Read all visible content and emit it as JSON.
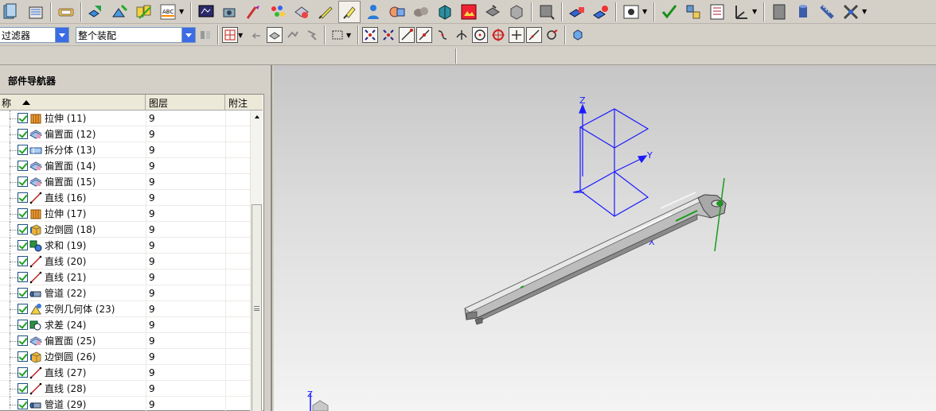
{
  "filter_bar": {
    "filter_combo": "过滤器",
    "scope_combo": "整个装配"
  },
  "navigator": {
    "title": "部件导航器",
    "columns": {
      "name": "称",
      "layer": "图层",
      "note": "附注"
    },
    "rows": [
      {
        "name": "拉伸 (11)",
        "layer": "9",
        "icon": "extrude-icon"
      },
      {
        "name": "偏置面 (12)",
        "layer": "9",
        "icon": "offset-face-icon"
      },
      {
        "name": "拆分体 (13)",
        "layer": "9",
        "icon": "split-body-icon"
      },
      {
        "name": "偏置面 (14)",
        "layer": "9",
        "icon": "offset-face-icon"
      },
      {
        "name": "偏置面 (15)",
        "layer": "9",
        "icon": "offset-face-icon"
      },
      {
        "name": "直线 (16)",
        "layer": "9",
        "icon": "line-icon"
      },
      {
        "name": "拉伸 (17)",
        "layer": "9",
        "icon": "extrude-icon"
      },
      {
        "name": "边倒圆 (18)",
        "layer": "9",
        "icon": "edge-blend-icon"
      },
      {
        "name": "求和 (19)",
        "layer": "9",
        "icon": "unite-icon"
      },
      {
        "name": "直线 (20)",
        "layer": "9",
        "icon": "line-icon"
      },
      {
        "name": "直线 (21)",
        "layer": "9",
        "icon": "line-icon"
      },
      {
        "name": "管道 (22)",
        "layer": "9",
        "icon": "tube-icon"
      },
      {
        "name": "实例几何体 (23)",
        "layer": "9",
        "icon": "instance-geometry-icon"
      },
      {
        "name": "求差 (24)",
        "layer": "9",
        "icon": "subtract-icon"
      },
      {
        "name": "偏置面 (25)",
        "layer": "9",
        "icon": "offset-face-icon"
      },
      {
        "name": "边倒圆 (26)",
        "layer": "9",
        "icon": "edge-blend-icon"
      },
      {
        "name": "直线 (27)",
        "layer": "9",
        "icon": "line-icon"
      },
      {
        "name": "直线 (28)",
        "layer": "9",
        "icon": "line-icon"
      },
      {
        "name": "管道 (29)",
        "layer": "9",
        "icon": "tube-icon"
      }
    ]
  },
  "viewport": {
    "axis_labels": {
      "x": "X",
      "y": "Y",
      "z": "Z"
    },
    "triad_label": "Z"
  },
  "colors": {
    "datum": "#1a1aff",
    "green_axis": "#1b9a1b",
    "part_gray": "#9a9a9a",
    "toolbar_bg": "#d4d0c8"
  }
}
